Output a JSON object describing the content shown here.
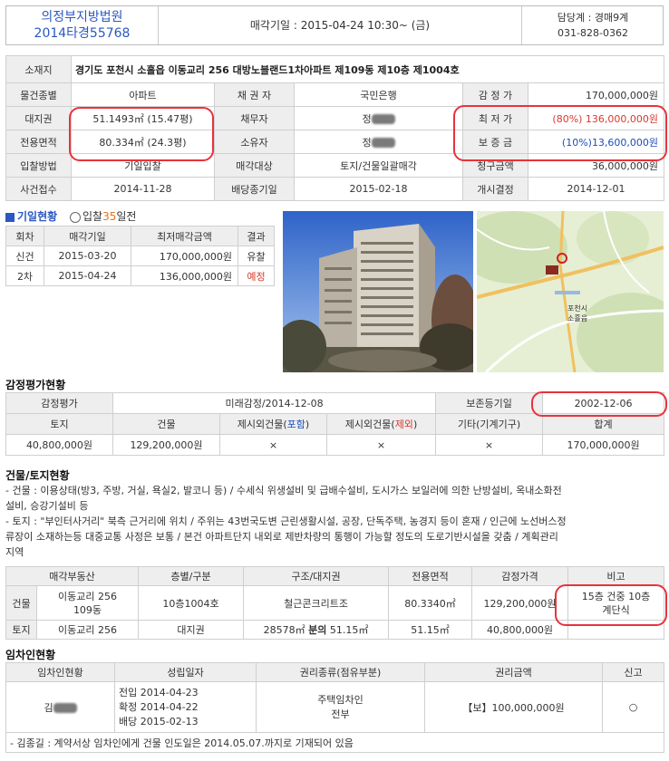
{
  "header": {
    "court_name": "의정부지방법원",
    "case_no": "2014타경55768",
    "sale_date_text": "매각기일 : 2015-04-24    10:30~ (금)",
    "manager": "담당계 : 경매9계",
    "phone": "031-828-0362"
  },
  "summary": {
    "location_label": "소재지",
    "location": "경기도 포천시 소흘읍 이동교리 256 대방노블랜드1차아파트 제109동 제10층 제1004호",
    "rows": [
      [
        {
          "l": "물건종별",
          "v": "아파트"
        },
        {
          "l": "채 권 자",
          "v": "국민은행"
        },
        {
          "l": "감 정 가",
          "v": "170,000,000원"
        }
      ],
      [
        {
          "l": "대지권",
          "v": "51.1493㎡ (15.47평)"
        },
        {
          "l": "채무자",
          "v": "정"
        },
        {
          "l": "최 저 가",
          "v": "(80%) 136,000,000원"
        }
      ],
      [
        {
          "l": "전용면적",
          "v": "80.334㎡ (24.3평)"
        },
        {
          "l": "소유자",
          "v": "정"
        },
        {
          "l": "보 증 금",
          "v": "(10%)13,600,000원"
        }
      ],
      [
        {
          "l": "입찰방법",
          "v": "기일입찰"
        },
        {
          "l": "매각대상",
          "v": "토지/건물일괄매각"
        },
        {
          "l": "청구금액",
          "v": "36,000,000원"
        }
      ],
      [
        {
          "l": "사건접수",
          "v": "2014-11-28"
        },
        {
          "l": "배당종기일",
          "v": "2015-02-18"
        },
        {
          "l": "개시결정",
          "v": "2014-12-01"
        }
      ]
    ]
  },
  "tabs": {
    "bid_status": "기일현황",
    "bid_before": "입찰",
    "bid_days": "35",
    "bid_after": "일전"
  },
  "bid_table": {
    "headers": [
      "회차",
      "매각기일",
      "최저매각금액",
      "결과"
    ],
    "rows": [
      [
        "신건",
        "2015-03-20",
        "170,000,000원",
        "유찰"
      ],
      [
        "2차",
        "2015-04-24",
        "136,000,000원",
        "예정"
      ]
    ]
  },
  "appraisal": {
    "title": "감정평가현황",
    "appraiser_label": "감정평가",
    "appraiser": "미래감정/2014-12-08",
    "reg_label": "보존등기일",
    "reg_date": "2002-12-06",
    "headers": {
      "land": "토지",
      "building": "건물",
      "extra_incl_pre": "제시외건물(",
      "extra_incl_mid": "포함",
      "extra_incl_post": ")",
      "extra_excl_pre": "제시외건물(",
      "extra_excl_mid": "제외",
      "extra_excl_post": ")",
      "other": "기타(기계기구)",
      "total": "합계"
    },
    "values": [
      "40,800,000원",
      "129,200,000원",
      "×",
      "×",
      "×",
      "170,000,000원"
    ]
  },
  "building_land": {
    "title": "건물/토지현황",
    "line1": "- 건물 : 이용상태(방3, 주방, 거실, 욕실2, 발코니 등) / 수세식 위생설비 및 급배수설비, 도시가스 보일러에 의한 난방설비, 옥내소화전",
    "line1b": "설비, 승강기설비 등",
    "line2": "- 토지 : \"부인터사거리\" 북측 근거리에 위치 / 주위는 43번국도변 근린생활시설, 공장, 단독주택, 농경지 등이 혼재 / 인근에 노선버스정",
    "line2b": "류장이 소재하는등 대중교통 사정은 보통 / 본건 아파트단지 내외로 제반차량의 통행이 가능할 정도의 도로기반시설을 갖춤 / 계획관리",
    "line2c": "지역",
    "headers": [
      "매각부동산",
      "층별/구분",
      "구조/대지권",
      "전용면적",
      "감정가격",
      "비고"
    ],
    "building_label": "건물",
    "building": {
      "addr1": "이동교리 256",
      "addr2": "109동",
      "floor": "10층1004호",
      "structure": "철근콘크리트조",
      "area": "80.3340㎡",
      "price": "129,200,000원",
      "note1": "15층 건중 10층",
      "note2": "계단식"
    },
    "land_label": "토지",
    "land": {
      "addr": "이동교리 256",
      "floor": "대지권",
      "structure_pre": "28578㎡ ",
      "structure_bold": "분의",
      "structure_post": " 51.15㎡",
      "area": "51.15㎡",
      "price": "40,800,000원"
    }
  },
  "tenant": {
    "title": "임차인현황",
    "headers": [
      "임차인현황",
      "성립일자",
      "권리종류(점유부분)",
      "권리금액",
      "신고"
    ],
    "name": "김",
    "dates": [
      "전입 2014-04-23",
      "확정 2014-04-22",
      "배당 2015-02-13"
    ],
    "right1": "주택임차인",
    "right2": "전부",
    "amount": "【보】100,000,000원",
    "report": "○",
    "note": "- 김종길 : 계약서상 임차인에게 건물 인도일은 2014.05.07.까지로 기재되어 있음"
  },
  "map": {
    "label1": "포천시",
    "label2": "소흘읍"
  },
  "colors": {
    "accent": "#2b58c2",
    "red": "#d63a2f",
    "mark": "#e8323c"
  }
}
